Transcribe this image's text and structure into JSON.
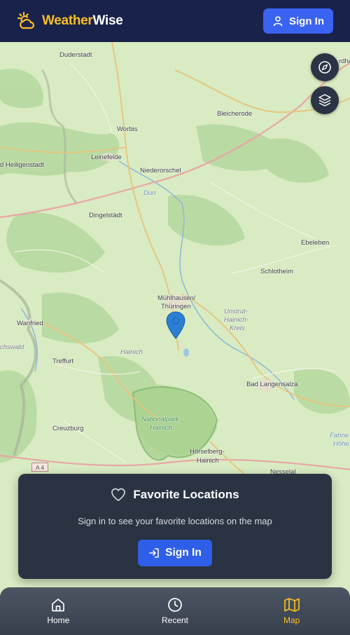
{
  "header": {
    "brand_part1": "Weather",
    "brand_part2": "Wise",
    "signin_label": "Sign In"
  },
  "map": {
    "places": [
      {
        "id": "duderstadt",
        "label": "Duderstadt"
      },
      {
        "id": "nordhausen",
        "label": "rdha"
      },
      {
        "id": "bleicherode",
        "label": "Bleicherode"
      },
      {
        "id": "worbis",
        "label": "Worbis"
      },
      {
        "id": "leinefelde",
        "label": "Leinefelde"
      },
      {
        "id": "heiligenstadt",
        "label": "d Heiligenstadt"
      },
      {
        "id": "niederorschel",
        "label": "Niederorschel"
      },
      {
        "id": "dun",
        "label": "Dun"
      },
      {
        "id": "dingelstadt",
        "label": "Dingelstädt"
      },
      {
        "id": "ebeleben",
        "label": "Ebeleben"
      },
      {
        "id": "schlotheim",
        "label": "Schlotheim"
      },
      {
        "id": "muehlhausen1",
        "label": "Mühlhausen/"
      },
      {
        "id": "muehlhausen2",
        "label": "Thüringen"
      },
      {
        "id": "unstrut1",
        "label": "Unstrut-"
      },
      {
        "id": "unstrut2",
        "label": "Hainich-"
      },
      {
        "id": "unstrut3",
        "label": "Kreis"
      },
      {
        "id": "wanfried",
        "label": "Wanfried"
      },
      {
        "id": "eschwald",
        "label": "chswald"
      },
      {
        "id": "hainich",
        "label": "Hainich"
      },
      {
        "id": "treffurt",
        "label": "Treffurt"
      },
      {
        "id": "badlangensalza",
        "label": "Bad Langensalza"
      },
      {
        "id": "nationalpark1",
        "label": "Nationalpark"
      },
      {
        "id": "nationalpark2",
        "label": "Hainich"
      },
      {
        "id": "creuzburg",
        "label": "Creuzburg"
      },
      {
        "id": "fahner1",
        "label": "Fahne"
      },
      {
        "id": "fahner2",
        "label": "Höhe"
      },
      {
        "id": "hoerselberg1",
        "label": "Hörselberg-"
      },
      {
        "id": "hoerselberg2",
        "label": "Hainich"
      },
      {
        "id": "nesselal",
        "label": "Nesselal"
      }
    ],
    "road_shield": "A 4"
  },
  "favorites": {
    "title": "Favorite Locations",
    "description": "Sign in to see your favorite locations on the map",
    "signin_label": "Sign In"
  },
  "nav": {
    "home": "Home",
    "recent": "Recent",
    "map": "Map"
  },
  "colors": {
    "header_bg": "#19224a",
    "accent_yellow": "#fbbf24",
    "primary_blue": "#3b63f1",
    "card_bg": "#2a3342",
    "marker_blue": "#2a7fd4"
  }
}
